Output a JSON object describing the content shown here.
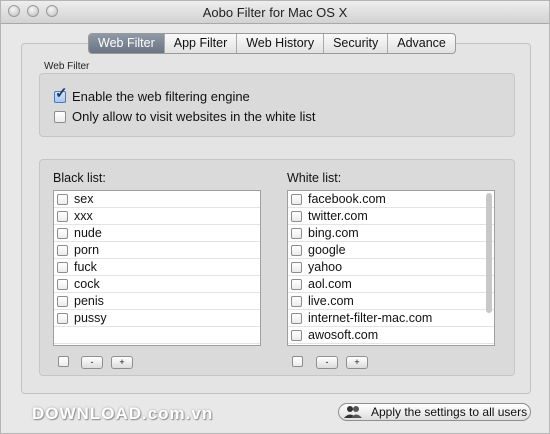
{
  "window": {
    "title": "Aobo Filter for Mac OS X"
  },
  "tabs": [
    {
      "label": "Web Filter",
      "active": true
    },
    {
      "label": "App Filter",
      "active": false
    },
    {
      "label": "Web History",
      "active": false
    },
    {
      "label": "Security",
      "active": false
    },
    {
      "label": "Advance",
      "active": false
    }
  ],
  "web_filter": {
    "section_title": "Web Filter",
    "options": [
      {
        "label": "Enable the web filtering engine",
        "checked": true
      },
      {
        "label": "Only allow to visit websites in the white list",
        "checked": false
      }
    ]
  },
  "black_list": {
    "label": "Black list:",
    "items": [
      "sex",
      "xxx",
      "nude",
      "porn",
      "fuck",
      "cock",
      "penis",
      "pussy"
    ],
    "remove_label": "-",
    "add_label": "+"
  },
  "white_list": {
    "label": "White list:",
    "items": [
      "facebook.com",
      "twitter.com",
      "bing.com",
      "google",
      "yahoo",
      "aol.com",
      "live.com",
      "internet-filter-mac.com",
      "awosoft.com"
    ],
    "remove_label": "-",
    "add_label": "+"
  },
  "footer": {
    "watermark": "DOWNLOAD.com.vn",
    "apply_label": "Apply the settings to all users"
  },
  "colors": {
    "active_tab": "#7a8493",
    "checkbox_checked": "#a9c6ef"
  }
}
